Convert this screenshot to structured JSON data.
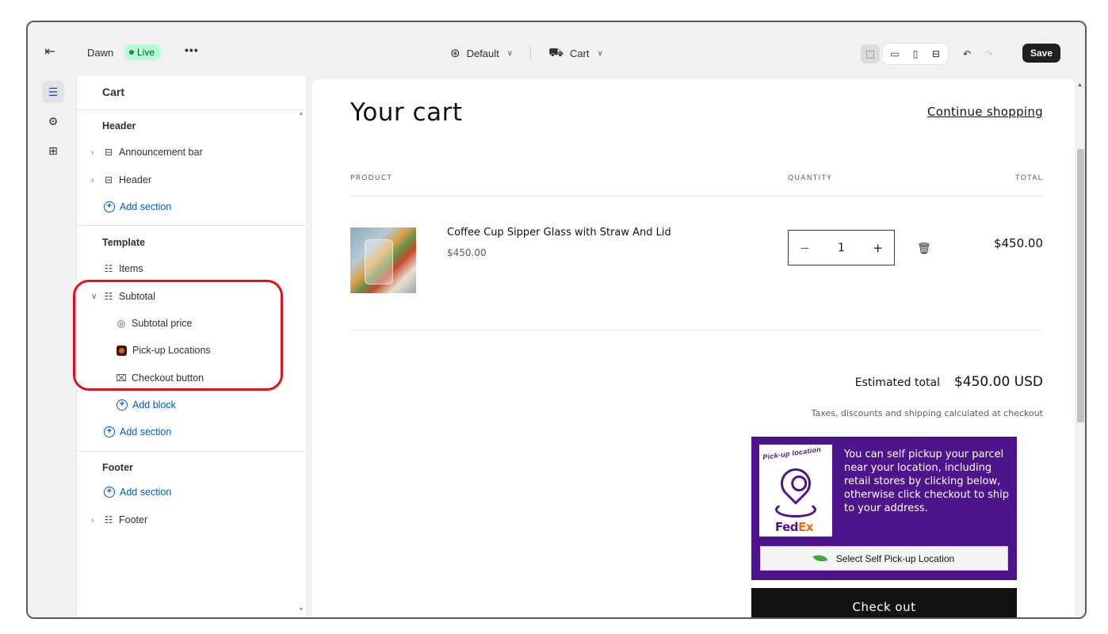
{
  "topbar": {
    "theme_name": "Dawn",
    "live_badge": "Live",
    "more_label": "•••",
    "template_dropdown": "Default",
    "page_dropdown": "Cart",
    "save_label": "Save"
  },
  "sidebar": {
    "title": "Cart",
    "groups": {
      "header": {
        "title": "Header",
        "items": [
          "Announcement bar",
          "Header"
        ],
        "add_section": "Add section"
      },
      "template": {
        "title": "Template",
        "items": [
          "Items"
        ],
        "subtotal": {
          "label": "Subtotal",
          "blocks": [
            "Subtotal price",
            "Pick-up Locations",
            "Checkout button"
          ],
          "add_block": "Add block"
        },
        "add_section": "Add section"
      },
      "footer": {
        "title": "Footer",
        "add_section": "Add section",
        "items": [
          "Footer"
        ]
      }
    }
  },
  "preview": {
    "title": "Your cart",
    "continue_link": "Continue shopping",
    "columns": {
      "product": "PRODUCT",
      "quantity": "QUANTITY",
      "total": "TOTAL"
    },
    "item": {
      "name": "Coffee Cup Sipper Glass with Straw And Lid",
      "price": "$450.00",
      "quantity": "1",
      "line_total": "$450.00"
    },
    "estimated_label": "Estimated total",
    "estimated_amount": "$450.00 USD",
    "tax_note": "Taxes, discounts and shipping calculated at checkout",
    "pickup": {
      "logo_arc": "Pick-up location",
      "logo_brand_fe": "Fed",
      "logo_brand_ex": "Ex",
      "text": "You can self pickup your parcel near your location, including retail stores by clicking below, otherwise click checkout to ship to your address.",
      "button": "Select Self Pick-up Location"
    },
    "checkout": "Check out"
  },
  "colors": {
    "accent_link": "#005bd3",
    "live_badge_bg": "#b4fed2",
    "fedex_purple": "#4d148c",
    "fedex_orange": "#ff6600",
    "highlight_red": "#e0101f",
    "checkout_bg": "#121212"
  },
  "icons": {
    "exit": "exit-icon",
    "sections": "sections-icon",
    "settings": "gear-icon",
    "apps": "apps-icon",
    "globe": "globe-icon",
    "cart": "cart-icon",
    "trash": "trash-icon"
  }
}
